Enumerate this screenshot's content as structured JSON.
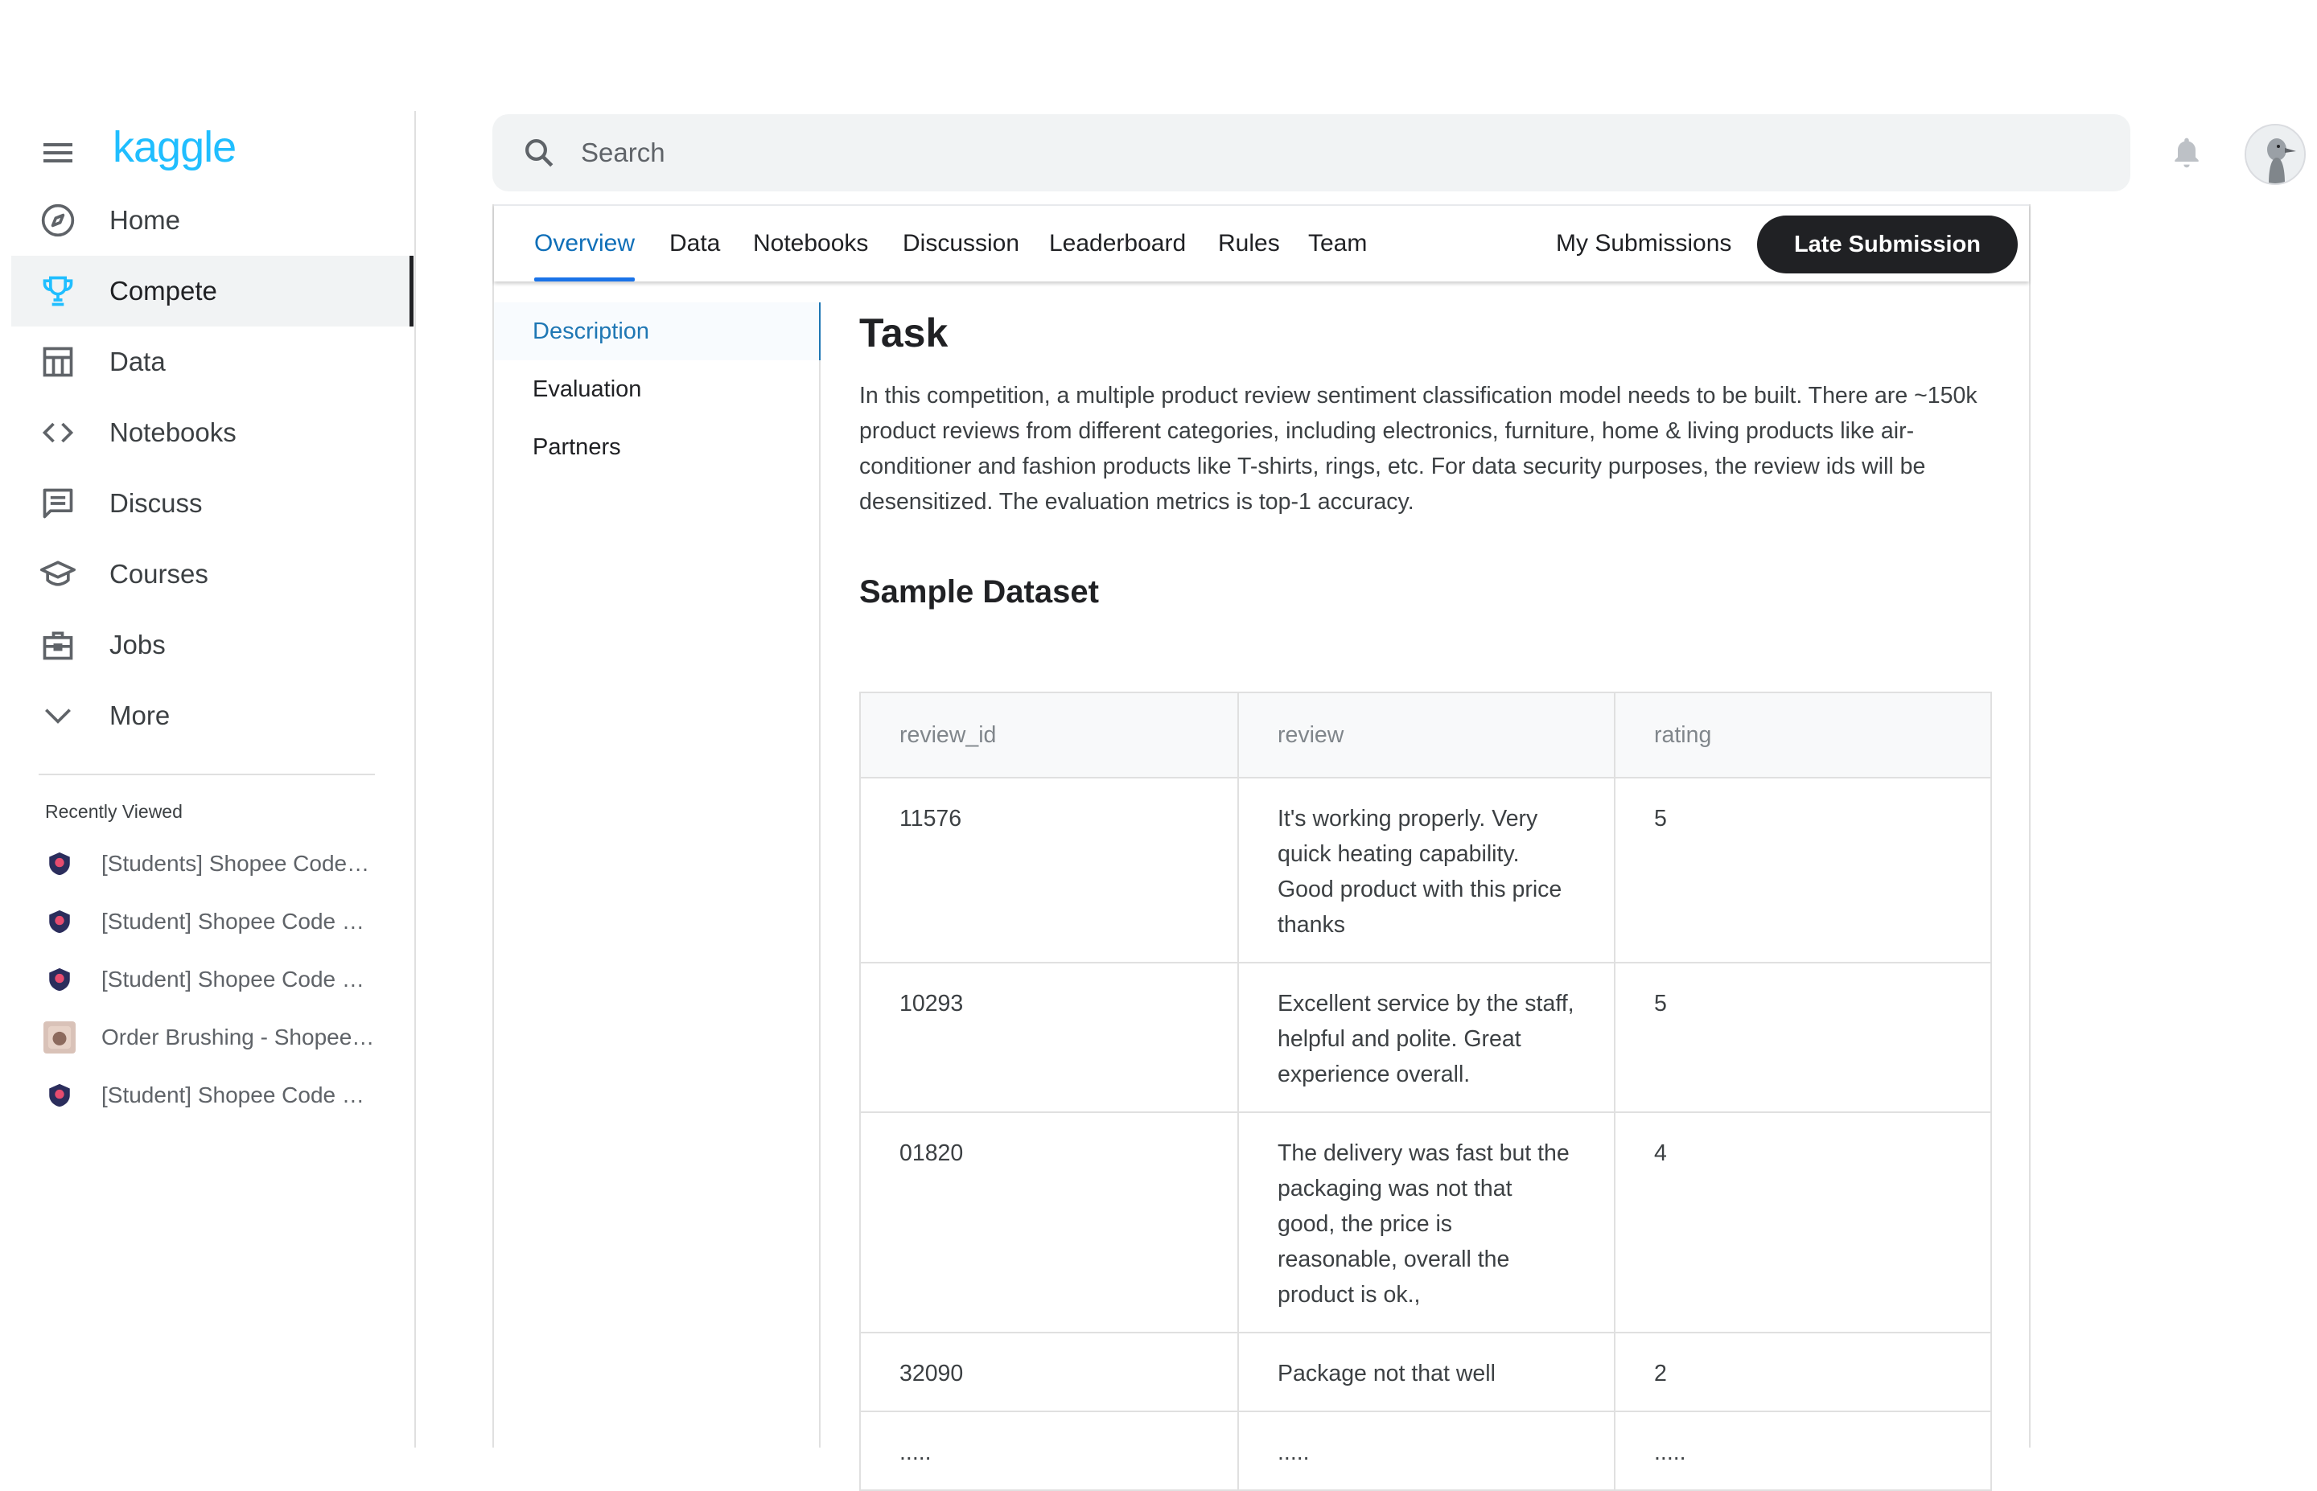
{
  "app": {
    "logo_text": "kaggle"
  },
  "sidebar": {
    "items": [
      {
        "label": "Home",
        "icon": "compass-icon",
        "active": false
      },
      {
        "label": "Compete",
        "icon": "trophy-icon",
        "active": true
      },
      {
        "label": "Data",
        "icon": "table-icon",
        "active": false
      },
      {
        "label": "Notebooks",
        "icon": "code-icon",
        "active": false
      },
      {
        "label": "Discuss",
        "icon": "comment-icon",
        "active": false
      },
      {
        "label": "Courses",
        "icon": "school-icon",
        "active": false
      },
      {
        "label": "Jobs",
        "icon": "briefcase-icon",
        "active": false
      },
      {
        "label": "More",
        "icon": "chevron-down-icon",
        "active": false
      }
    ],
    "recent_title": "Recently Viewed",
    "recent": [
      {
        "label": "[Students] Shopee Code League - Sentiment Analysis"
      },
      {
        "label": "[Student] Shopee Code League - Product Detection"
      },
      {
        "label": "[Student] Shopee Code League - Marketing Analytics"
      },
      {
        "label": "Order Brushing - Shopee Code League"
      },
      {
        "label": "[Student] Shopee Code League - Address Elements Extraction"
      }
    ]
  },
  "search": {
    "placeholder": "Search",
    "value": ""
  },
  "colors": {
    "accent": "#20beff",
    "tab_active": "#0f6fb8",
    "button_bg": "#202124"
  },
  "tabs": [
    {
      "label": "Overview",
      "active": true
    },
    {
      "label": "Data"
    },
    {
      "label": "Notebooks"
    },
    {
      "label": "Discussion"
    },
    {
      "label": "Leaderboard"
    },
    {
      "label": "Rules"
    },
    {
      "label": "Team"
    },
    {
      "label": "My Submissions"
    }
  ],
  "late_submission_label": "Late Submission",
  "subnav": [
    {
      "label": "Description",
      "active": true
    },
    {
      "label": "Evaluation"
    },
    {
      "label": "Partners"
    }
  ],
  "content": {
    "title": "Task",
    "paragraph": "In this competition, a multiple product review sentiment classification model needs to be built. There are ~150k product reviews from different categories, including electronics, furniture, home & living products like air-conditioner and fashion products like T-shirts, rings, etc. For data security purposes, the review ids will be desensitized. The evaluation metrics is top-1 accuracy.",
    "section_title": "Sample Dataset"
  },
  "table": {
    "headers": [
      "review_id",
      "review",
      "rating"
    ],
    "rows": [
      [
        "11576",
        "It's working properly. Very quick heating capability. Good product with this price thanks",
        "5"
      ],
      [
        "10293",
        "Excellent service by the staff, helpful and polite. Great experience overall.",
        "5"
      ],
      [
        "01820",
        "The delivery was fast but the packaging was not that good, the price is reasonable, overall the product is ok.,",
        "4"
      ],
      [
        "32090",
        "Package not that well",
        "2"
      ],
      [
        ".....",
        ".....",
        "....."
      ]
    ]
  }
}
